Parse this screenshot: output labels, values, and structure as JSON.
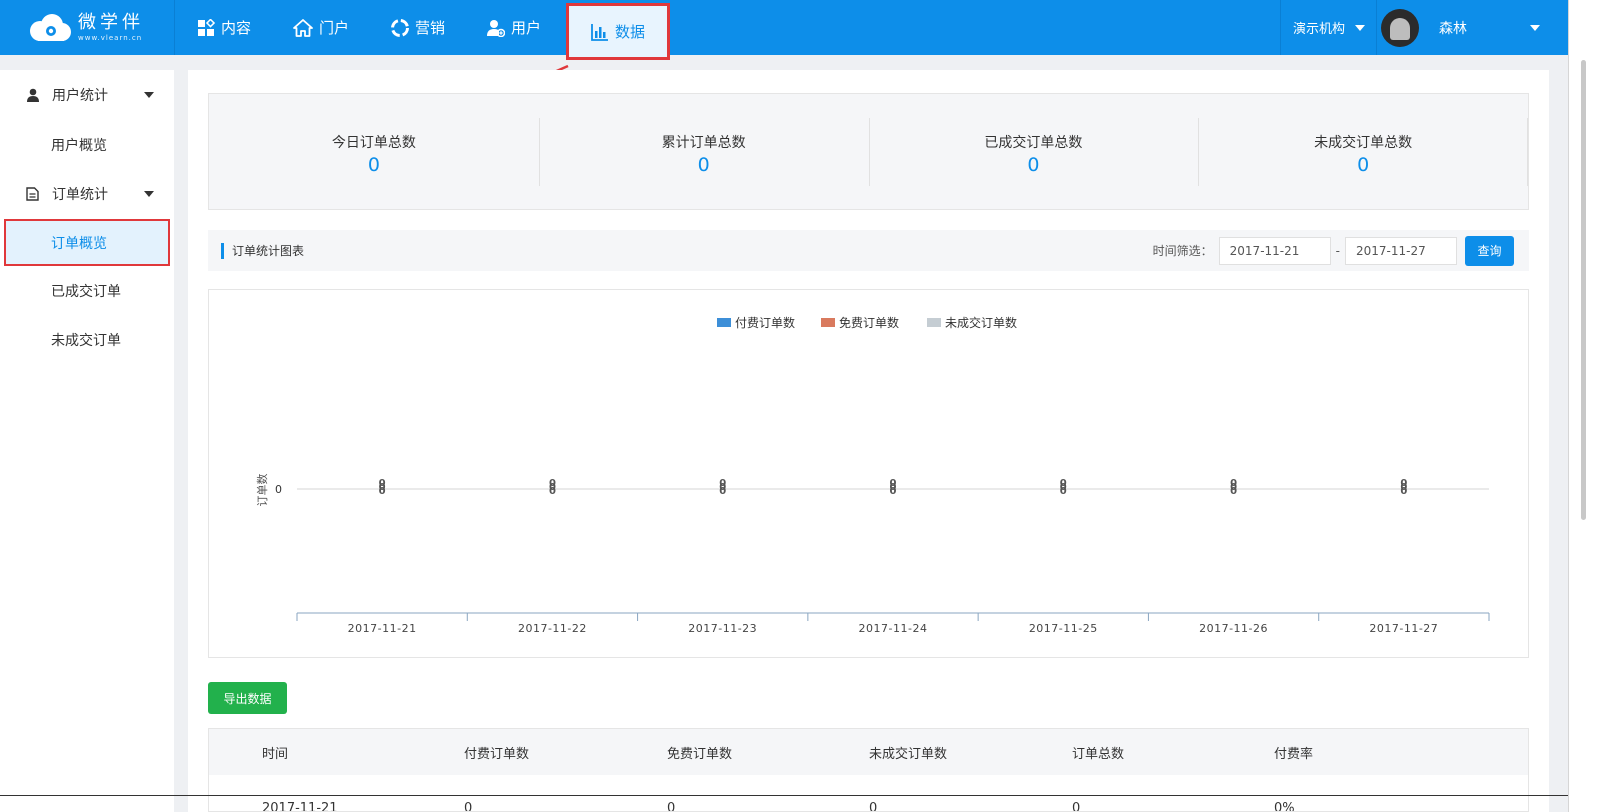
{
  "brand": {
    "name": "微学伴",
    "domain": "www.vlearn.cn"
  },
  "nav": [
    {
      "label": "内容",
      "icon": "content-grid-icon"
    },
    {
      "label": "门户",
      "icon": "home-icon"
    },
    {
      "label": "营销",
      "icon": "marketing-icon"
    },
    {
      "label": "用户",
      "icon": "user-add-icon"
    },
    {
      "label": "数据",
      "icon": "bar-chart-icon",
      "active": true
    }
  ],
  "org": "演示机构",
  "user": {
    "name": "森林"
  },
  "sidebar": {
    "groups": [
      {
        "label": "用户统计",
        "icon": "user-icon",
        "items": [
          "用户概览"
        ]
      },
      {
        "label": "订单统计",
        "icon": "document-icon",
        "items": [
          "订单概览",
          "已成交订单",
          "未成交订单"
        ]
      }
    ],
    "active_item": "订单概览"
  },
  "stats": [
    {
      "label": "今日订单总数",
      "value": "0"
    },
    {
      "label": "累计订单总数",
      "value": "0"
    },
    {
      "label": "已成交订单总数",
      "value": "0"
    },
    {
      "label": "未成交订单总数",
      "value": "0"
    }
  ],
  "chart_section": {
    "title": "订单统计图表",
    "filter_label": "时间筛选：",
    "date_from": "2017-11-21",
    "date_to": "2017-11-27",
    "separator": "-",
    "query_button": "查询"
  },
  "chart_data": {
    "type": "bar",
    "categories": [
      "2017-11-21",
      "2017-11-22",
      "2017-11-23",
      "2017-11-24",
      "2017-11-25",
      "2017-11-26",
      "2017-11-27"
    ],
    "series": [
      {
        "name": "付费订单数",
        "color": "#3d8fd8",
        "values": [
          0,
          0,
          0,
          0,
          0,
          0,
          0
        ]
      },
      {
        "name": "免费订单数",
        "color": "#d97a5e",
        "values": [
          0,
          0,
          0,
          0,
          0,
          0,
          0
        ]
      },
      {
        "name": "未成交订单数",
        "color": "#c5cdd3",
        "values": [
          0,
          0,
          0,
          0,
          0,
          0,
          0
        ]
      }
    ],
    "ylabel": "订单数",
    "yticks": [
      "0"
    ],
    "legend": "top-center"
  },
  "export_button": "导出数据",
  "table": {
    "headers": [
      "时间",
      "付费订单数",
      "免费订单数",
      "未成交订单数",
      "订单总数",
      "付费率"
    ],
    "rows": [
      [
        "2017-11-21",
        "0",
        "0",
        "0",
        "0",
        "0%"
      ]
    ]
  }
}
